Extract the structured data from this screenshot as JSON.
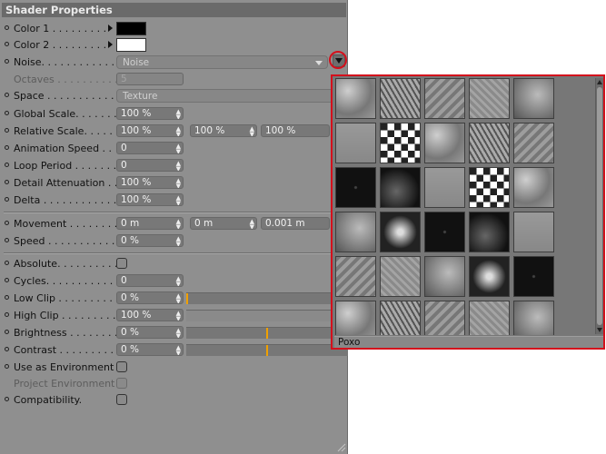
{
  "panel": {
    "title": "Shader Properties",
    "color1_label": "Color 1 . . . . . . . . .",
    "color1_value": "#000000",
    "color2_label": "Color 2 . . . . . . . . .",
    "color2_value": "#ffffff",
    "noise_label": "Noise. . . . . . . . . . . . .",
    "noise_value": "Noise",
    "octaves_label": "Octaves . . . . . . . . . .",
    "octaves_value": "5",
    "space_label": "Space . . . . . . . . . . . .",
    "space_value": "Texture",
    "global_scale_label": "Global Scale. . . . . . .",
    "global_scale_value": "100 %",
    "relative_scale_label": "Relative Scale. . . . . .",
    "relative_scale_values": [
      "100 %",
      "100 %",
      "100 %"
    ],
    "animation_speed_label": "Animation Speed . .",
    "animation_speed_value": "0",
    "loop_period_label": "Loop Period . . . . . . .",
    "loop_period_value": "0",
    "detail_attenuation_label": "Detail Attenuation . .",
    "detail_attenuation_value": "100 %",
    "delta_label": "Delta . . . . . . . . . . . .",
    "delta_value": "100 %",
    "movement_label": "Movement . . . . . . . .",
    "movement_values": [
      "0 m",
      "0 m",
      "0.001 m"
    ],
    "speed_label": "Speed . . . . . . . . . . . .",
    "speed_value": "0 %",
    "absolute_label": "Absolute. . . . . . . . . .",
    "absolute_checked": false,
    "cycles_label": "Cycles. . . . . . . . . . . .",
    "cycles_value": "0",
    "low_clip_label": "Low Clip . . . . . . . . . .",
    "low_clip_value": "0 %",
    "low_clip_fraction": 0.0,
    "high_clip_label": "High Clip . . . . . . . . . .",
    "high_clip_value": "100 %",
    "high_clip_fraction": 1.0,
    "brightness_label": "Brightness . . . . . . . . .",
    "brightness_value": "0 %",
    "brightness_fraction": 0.5,
    "contrast_label": "Contrast . . . . . . . . . .",
    "contrast_value": "0 %",
    "contrast_fraction": 0.5,
    "use_env_label": "Use as Environment",
    "use_env_checked": false,
    "project_env_label": "Project Environment",
    "project_env_checked": false,
    "compat_label": "Compatibility.",
    "compat_checked": false
  },
  "popup": {
    "selected_name": "Poxo",
    "tile_count": 30
  },
  "colors": {
    "panel_bg": "#8f8f8f",
    "highlight_red": "#d4101c",
    "slider_marker": "#f0a000"
  }
}
